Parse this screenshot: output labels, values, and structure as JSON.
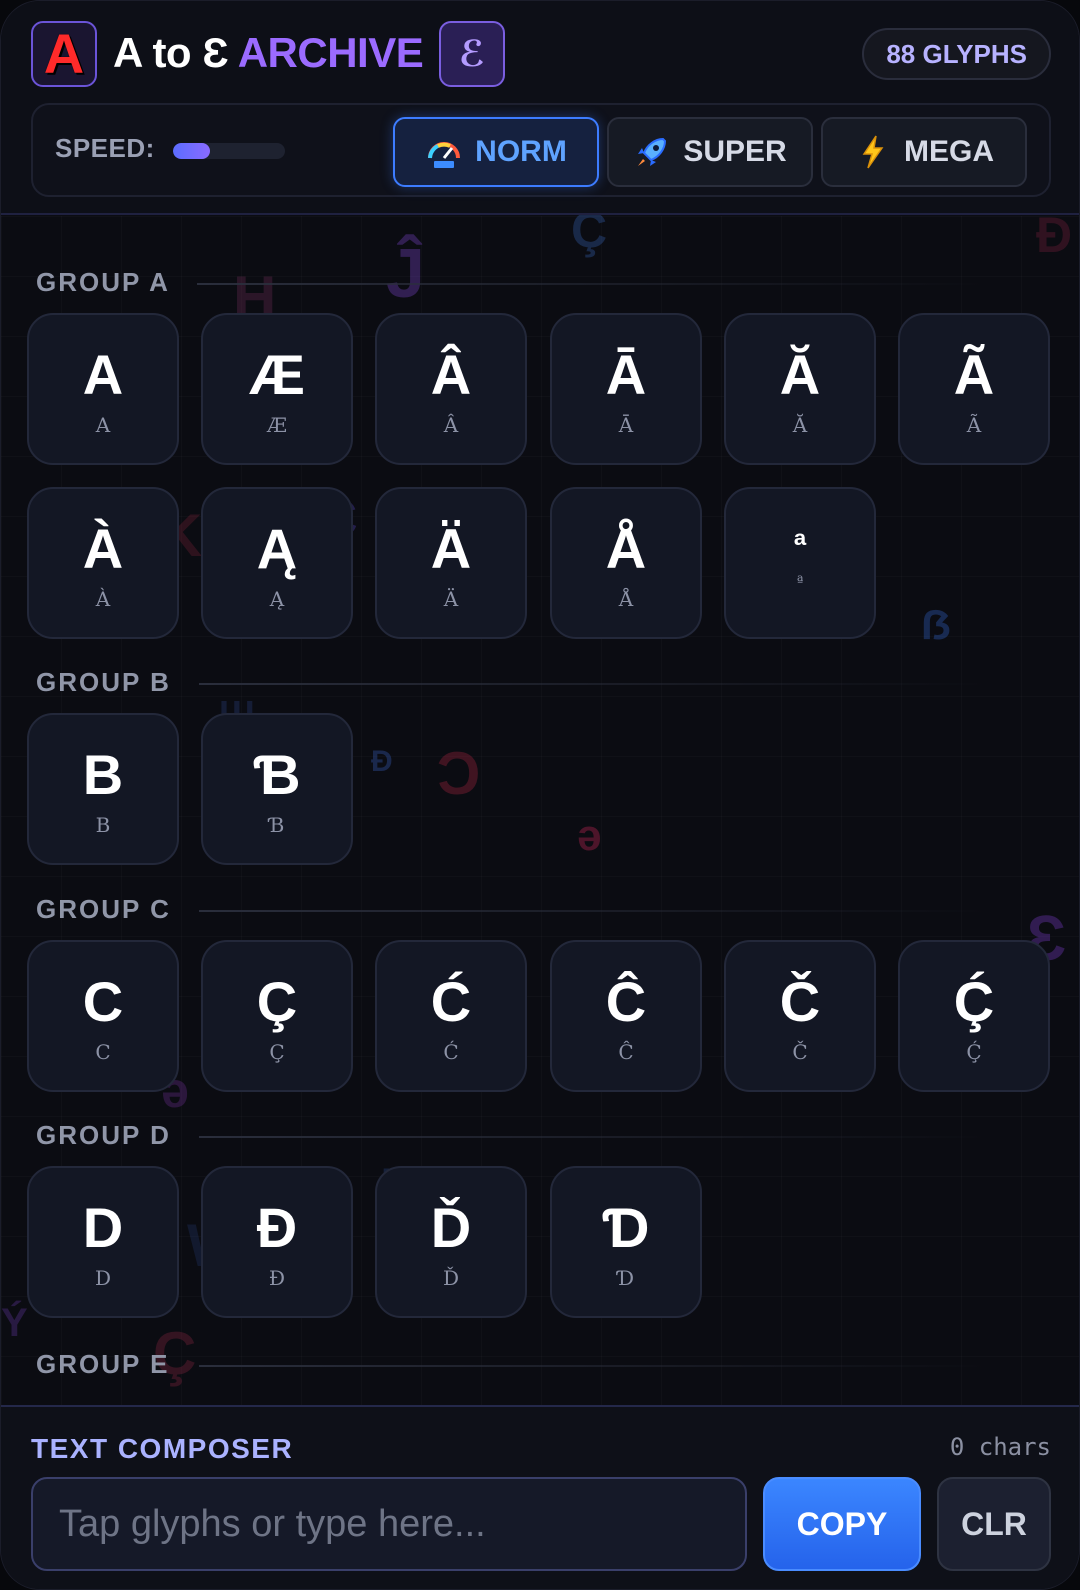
{
  "header": {
    "logo_letter": "A",
    "title_white": "A to Ɛ",
    "title_accent": "ARCHIVE",
    "badge_glyph": "ℰ",
    "glyph_count": "88 GLYPHS"
  },
  "speed": {
    "label": "SPEED:",
    "level": 0.33,
    "modes": [
      {
        "label": "NORM",
        "icon": "speedometer-icon",
        "active": true
      },
      {
        "label": "SUPER",
        "icon": "rocket-icon",
        "active": false
      },
      {
        "label": "MEGA",
        "icon": "lightning-icon",
        "active": false
      }
    ]
  },
  "groups": [
    {
      "label": "GROUP A",
      "glyphs": [
        "A",
        "Æ",
        "Â",
        "Ā",
        "Ă",
        "Ã",
        "À",
        "Ą",
        "Ä",
        "Å",
        "ª"
      ]
    },
    {
      "label": "GROUP B",
      "glyphs": [
        "B",
        "Ɓ"
      ]
    },
    {
      "label": "GROUP C",
      "glyphs": [
        "C",
        "Ç",
        "Ć",
        "Ĉ",
        "Č",
        "Ḉ"
      ]
    },
    {
      "label": "GROUP D",
      "glyphs": [
        "D",
        "Đ",
        "Ď",
        "Ɗ"
      ]
    },
    {
      "label": "GROUP E",
      "glyphs": []
    }
  ],
  "composer": {
    "title": "TEXT COMPOSER",
    "char_count": "0 chars",
    "placeholder": "Tap glyphs or type here...",
    "copy_label": "COPY",
    "clear_label": "CLR"
  },
  "colors": {
    "accent_purple": "#9b6bff",
    "accent_blue": "#3d7cff",
    "logo_red": "#ff2a2a"
  }
}
